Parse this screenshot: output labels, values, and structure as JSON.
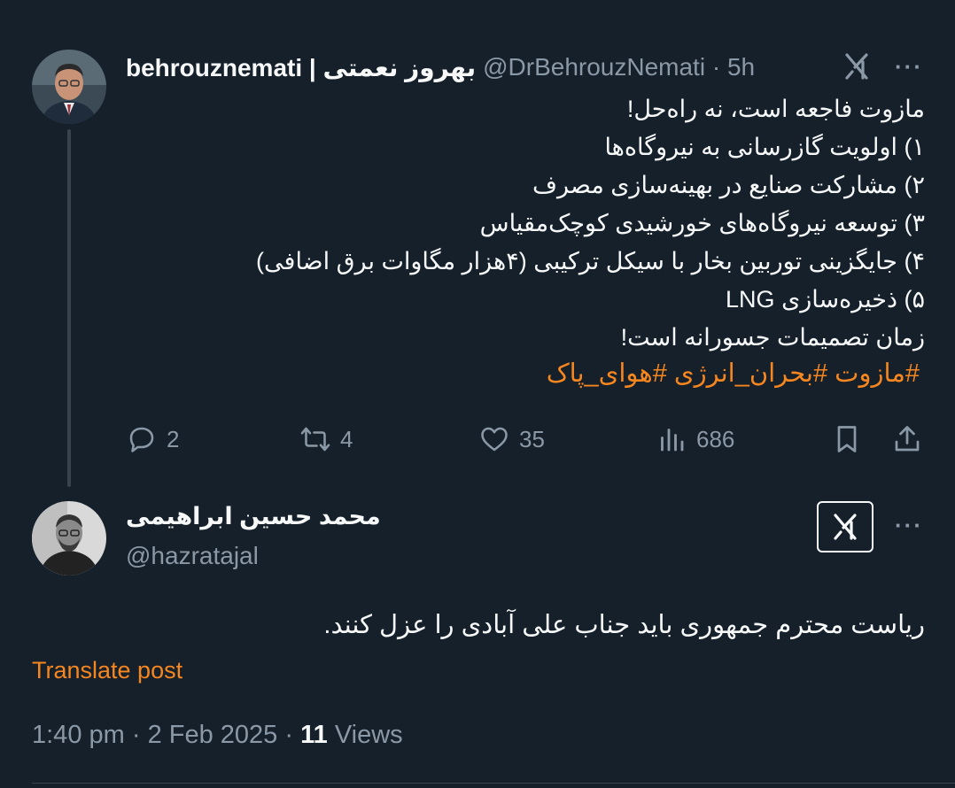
{
  "post1": {
    "display_name": "behrouznemati | بهروز نعمتی",
    "handle": "@DrBehrouzNemati",
    "time": "5h",
    "more_label": "···",
    "lines": [
      "مازوت فاجعه است، نه راه‌حل!",
      "۱) اولویت گازرسانی به نیروگاه‌ها",
      "۲) مشارکت صنایع در بهینه‌سازی مصرف",
      "۳) توسعه نیروگاه‌های خورشیدی کوچک‌مقیاس",
      "۴) جایگزینی توربین بخار با سیکل ترکیبی (۴هزار مگاوات برق اضافی)",
      "۵) ذخیره‌سازی LNG",
      "زمان تصمیمات جسورانه است!"
    ],
    "hashtags": "#مازوت #بحران_انرژی #هوای_پاک",
    "actions": {
      "replies": "2",
      "reposts": "4",
      "likes": "35",
      "views": "686"
    }
  },
  "post2": {
    "display_name": "محمد حسین ابراهیمی",
    "handle": "@hazratajal",
    "more_label": "···",
    "text": "ریاست محترم جمهوری باید جناب علی آبادی را عزل کنند.",
    "translate_label": "Translate post",
    "time": "1:40 pm",
    "date": "2 Feb 2025",
    "views_count": "11",
    "views_label": "Views"
  },
  "colors": {
    "background": "#15202b",
    "text": "#f7f9f9",
    "muted": "#8b98a5",
    "accent": "#f6861f",
    "divider": "#38444d"
  },
  "icons": [
    "grok-icon",
    "more-icon",
    "reply-icon",
    "repost-icon",
    "like-icon",
    "views-icon",
    "bookmark-icon",
    "share-icon"
  ]
}
